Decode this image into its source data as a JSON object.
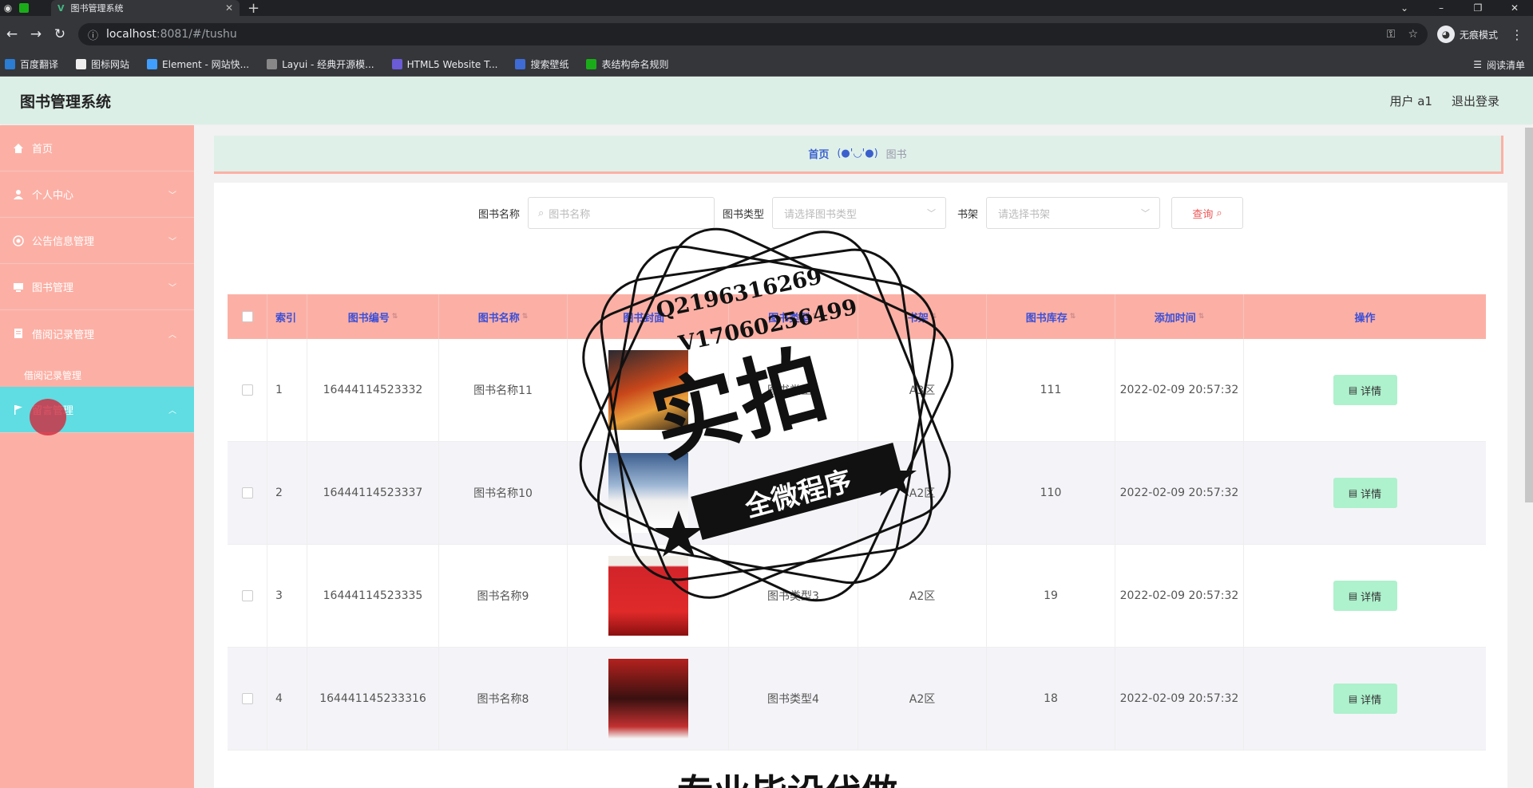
{
  "browser": {
    "tab_title": "图书管理系统",
    "url_host": "localhost",
    "url_path": ":8081/#/tushu",
    "incognito_label": "无痕模式",
    "reading_list_label": "阅读清单",
    "bookmarks": [
      {
        "label": "百度翻译",
        "color": "#2b7cd3"
      },
      {
        "label": "图标网站",
        "color": "#333333"
      },
      {
        "label": "Element - 网站快...",
        "color": "#409eff"
      },
      {
        "label": "Layui - 经典开源模...",
        "color": "#666666"
      },
      {
        "label": "HTML5 Website T...",
        "color": "#6b5bd6"
      },
      {
        "label": "搜索壁纸",
        "color": "#3e6bd6"
      },
      {
        "label": "表结构命名规则",
        "color": "#1aad19"
      }
    ]
  },
  "header": {
    "brand": "图书管理系统",
    "user": "用户 a1",
    "logout": "退出登录"
  },
  "sidebar": {
    "items": [
      {
        "label": "首页",
        "icon": "home-icon"
      },
      {
        "label": "个人中心",
        "icon": "user-icon"
      },
      {
        "label": "公告信息管理",
        "icon": "notice-icon"
      },
      {
        "label": "图书管理",
        "icon": "book-icon"
      },
      {
        "label": "借阅记录管理",
        "icon": "record-icon"
      },
      {
        "label": "借阅记录管理",
        "sub": true
      },
      {
        "label": "留言管理",
        "icon": "flag-icon",
        "active": true
      }
    ]
  },
  "breadcrumb": {
    "home": "首页",
    "separator": "(●'◡'●)",
    "current": "图书"
  },
  "search": {
    "name_label": "图书名称",
    "name_placeholder": "图书名称",
    "type_label": "图书类型",
    "type_placeholder": "请选择图书类型",
    "shelf_label": "书架",
    "shelf_placeholder": "请选择书架",
    "query_button": "查询"
  },
  "table": {
    "headers": [
      "索引",
      "图书编号",
      "图书名称",
      "图书封面",
      "图书类型",
      "书架",
      "图书库存",
      "添加时间",
      "操作"
    ],
    "detail_label": "详情",
    "rows": [
      {
        "index": "1",
        "code": "16444114523332",
        "name": "图书名称11",
        "type": "图书类型1",
        "shelf": "A3区",
        "stock": "111",
        "time": "2022-02-09 20:57:32",
        "cover_color": "#c8461a"
      },
      {
        "index": "2",
        "code": "16444114523337",
        "name": "图书名称10",
        "type": "图书类型2",
        "shelf": "A2区",
        "stock": "110",
        "time": "2022-02-09 20:57:32",
        "cover_color": "#5b86b8"
      },
      {
        "index": "3",
        "code": "16444114523335",
        "name": "图书名称9",
        "type": "图书类型3",
        "shelf": "A2区",
        "stock": "19",
        "time": "2022-02-09 20:57:32",
        "cover_color": "#d2242a"
      },
      {
        "index": "4",
        "code": "164441145233316",
        "name": "图书名称8",
        "type": "图书类型4",
        "shelf": "A2区",
        "stock": "18",
        "time": "2022-02-09 20:57:32",
        "cover_color": "#b3221e"
      }
    ]
  },
  "watermark": {
    "line1": "Q2196316269",
    "line2": "V17060256499",
    "big": "实拍",
    "banner": "全微程序",
    "bottom": "专业毕设代做"
  }
}
